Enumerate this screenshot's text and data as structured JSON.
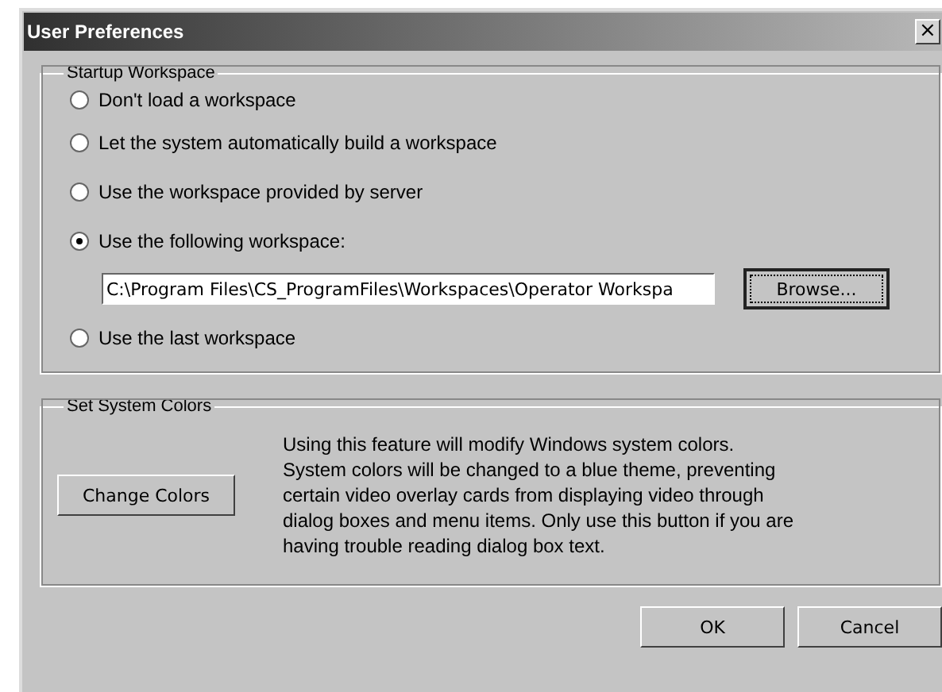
{
  "window": {
    "title": "User Preferences",
    "close": "×"
  },
  "startup_workspace": {
    "title": "Startup Workspace",
    "options": [
      {
        "label": "Don't load a workspace",
        "selected": false
      },
      {
        "label": "Let the system automatically build a workspace",
        "selected": false
      },
      {
        "label": "Use the workspace provided by server",
        "selected": false
      },
      {
        "label": "Use the following workspace:",
        "selected": true
      },
      {
        "label": "Use the last workspace",
        "selected": false
      }
    ],
    "path": "C:\\Program Files\\CS_ProgramFiles\\Workspaces\\Operator Workspa",
    "browse": "Browse..."
  },
  "system_colors": {
    "title": "Set System Colors",
    "button": "Change Colors",
    "description": "Using this feature will modify Windows system colors.  System colors will be changed to a blue theme, preventing certain video overlay cards from displaying video through dialog boxes and menu items.  Only use this button if you are having trouble reading dialog box text."
  },
  "buttons": [
    "OK",
    "Cancel"
  ]
}
